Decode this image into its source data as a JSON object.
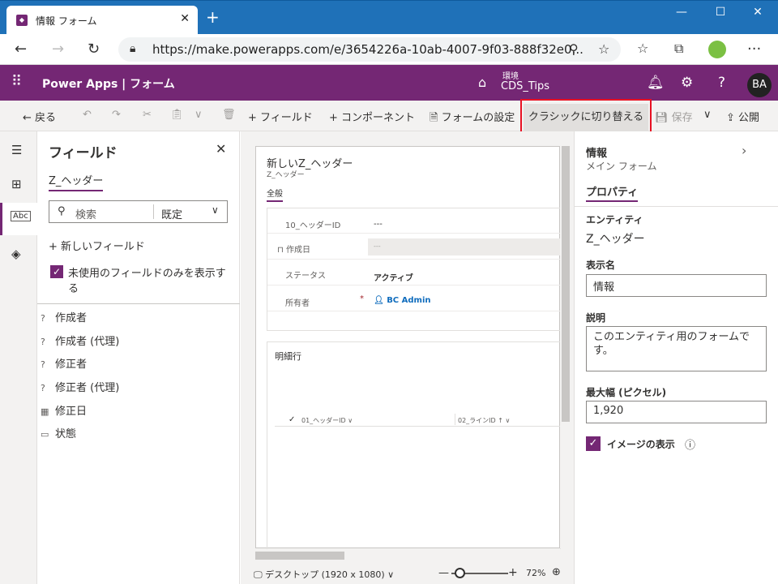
{
  "browser": {
    "tab_title": "情報 フォーム",
    "tab_close": "✕",
    "new_tab": "+",
    "window_controls": [
      "—",
      "☐",
      "✕"
    ],
    "url": "https://make.powerapps.com/e/3654226a-10ab-4007-9f03-888f32e0..."
  },
  "app": {
    "brand": "Power Apps",
    "separator": "|",
    "page": "フォーム",
    "env_label": "環境",
    "env_value": "CDS_Tips",
    "avatar": "BA"
  },
  "command_bar": {
    "back": "戻る",
    "add_field": "フィールド",
    "add_component": "コンポーネント",
    "form_settings": "フォームの設定",
    "switch_classic": "クラシックに切り替える",
    "save": "保存",
    "publish": "公開"
  },
  "fields_panel": {
    "title": "フィールド",
    "entity_tab": "Z_ヘッダー",
    "search_placeholder": "検索",
    "filter_selected": "既定",
    "new_field": "新しいフィールド",
    "only_unused": "未使用のフィールドのみを表示する",
    "items": [
      {
        "icon": "?",
        "label": "作成者"
      },
      {
        "icon": "?",
        "label": "作成者 (代理)"
      },
      {
        "icon": "?",
        "label": "修正者"
      },
      {
        "icon": "?",
        "label": "修正者 (代理)"
      },
      {
        "icon": "▦",
        "label": "修正日"
      },
      {
        "icon": "▭",
        "label": "状態"
      }
    ]
  },
  "form": {
    "title": "新しいZ_ヘッダー",
    "subtitle": "Z_ヘッダー",
    "tab": "全般",
    "rows": [
      {
        "label": "10_ヘッダーID",
        "value": "---"
      },
      {
        "label": "作成日",
        "value": "---"
      },
      {
        "label": "ステータス",
        "value": "アクティブ"
      },
      {
        "label": "所有者",
        "value": "BC Admin",
        "required": "*"
      }
    ],
    "subgrid_title": "明細行",
    "subgrid_cols": [
      "01_ヘッダーID",
      "02_ラインID ↑"
    ]
  },
  "bottom_bar": {
    "device": "デスクトップ (1920 x 1080)",
    "zoom": "72%"
  },
  "properties": {
    "header": "情報",
    "subheader": "メイン フォーム",
    "tab": "プロパティ",
    "entity_label": "エンティティ",
    "entity_value": "Z_ヘッダー",
    "display_name_label": "表示名",
    "display_name_value": "情報",
    "description_label": "説明",
    "description_value": "このエンティティ用のフォームです。",
    "max_width_label": "最大幅 (ピクセル)",
    "max_width_value": "1,920",
    "show_image_label": "イメージの表示"
  }
}
